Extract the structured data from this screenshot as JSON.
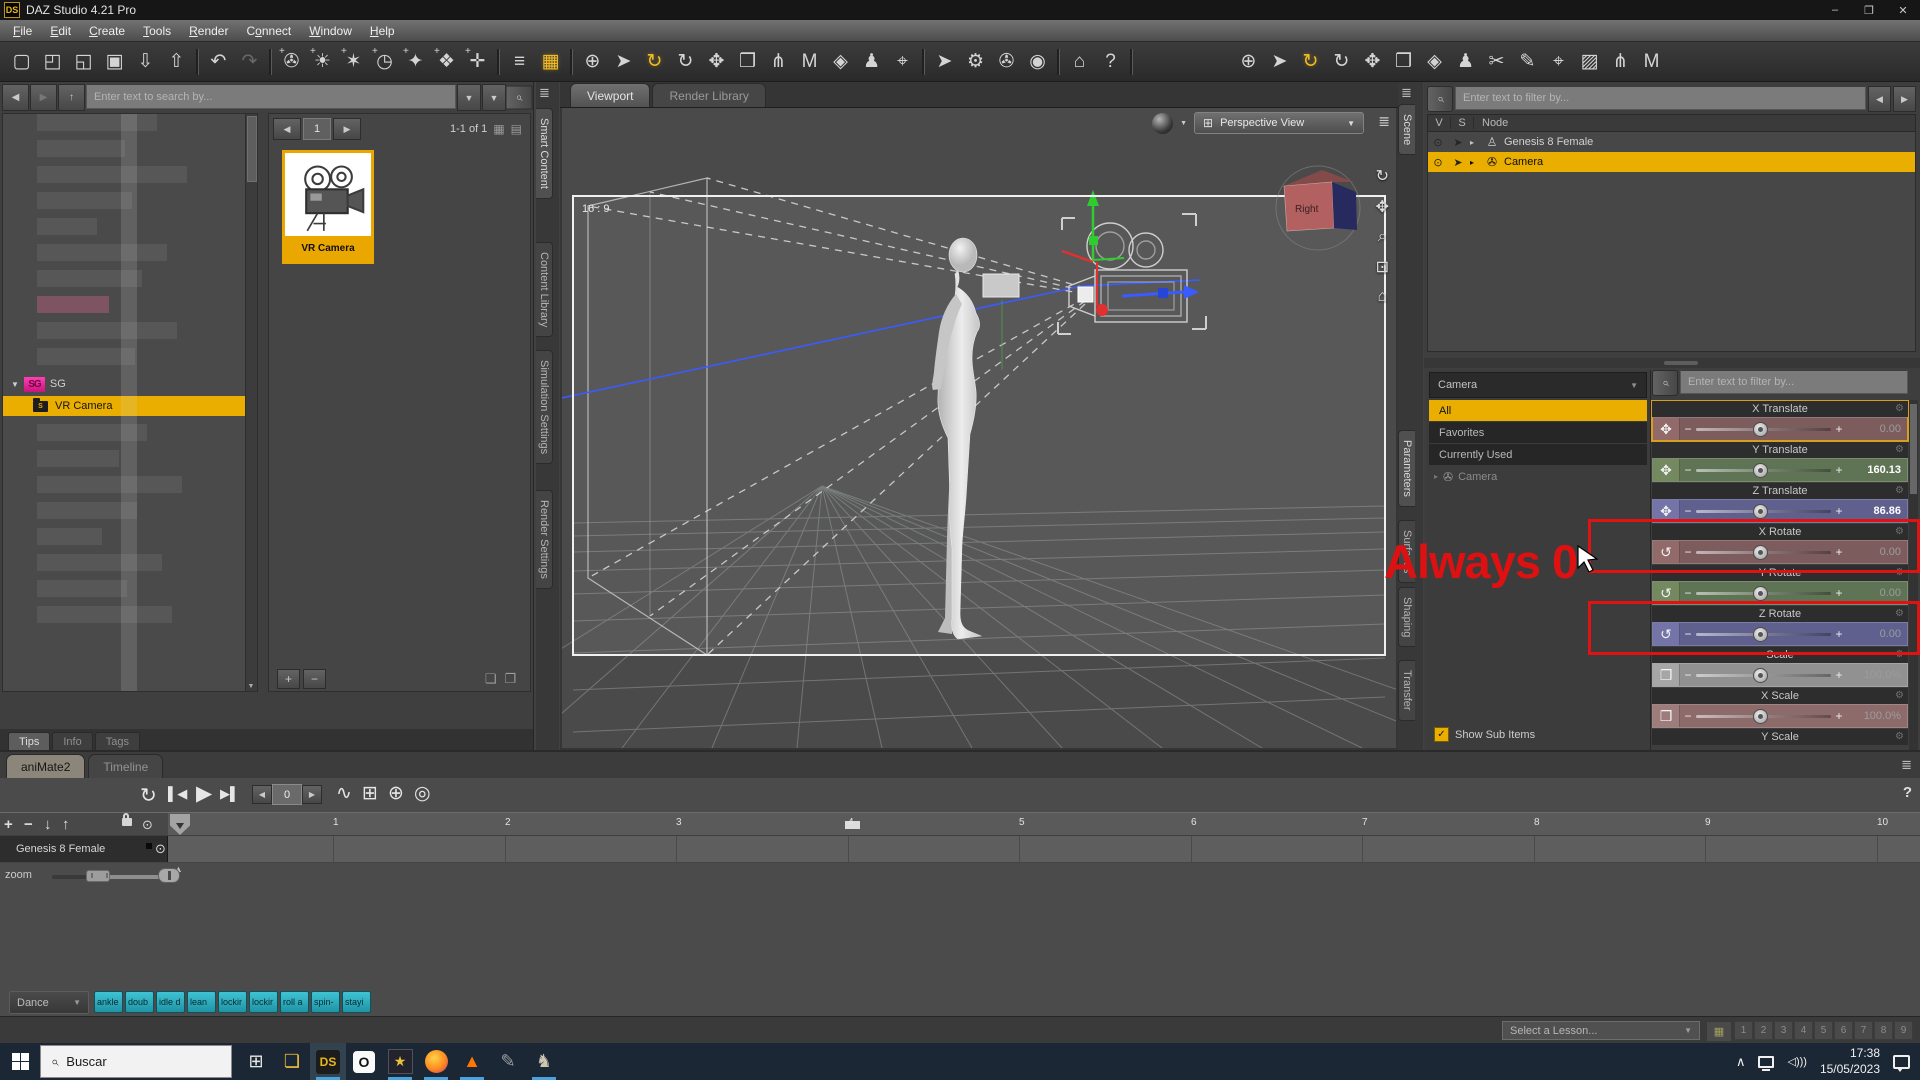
{
  "window": {
    "title": "DAZ Studio 4.21 Pro",
    "logo": "DS",
    "minimize": "–",
    "maximize": "❐",
    "close": "✕"
  },
  "menu": {
    "items": [
      {
        "label": "File",
        "u": 0
      },
      {
        "label": "Edit",
        "u": 0
      },
      {
        "label": "Create",
        "u": 0
      },
      {
        "label": "Tools",
        "u": 0
      },
      {
        "label": "Render",
        "u": 0
      },
      {
        "label": "Connect",
        "u": 1
      },
      {
        "label": "Window",
        "u": 0
      },
      {
        "label": "Help",
        "u": 0
      }
    ]
  },
  "toolbar": {
    "icons": [
      {
        "n": "new-file-icon",
        "g": "▢"
      },
      {
        "n": "open-file-icon",
        "g": "◰"
      },
      {
        "n": "merge-file-icon",
        "g": "◱"
      },
      {
        "n": "save-file-icon",
        "g": "▣"
      },
      {
        "n": "import-icon",
        "g": "⇩"
      },
      {
        "n": "export-icon",
        "g": "⇧"
      },
      {
        "sep": true
      },
      {
        "n": "undo-icon",
        "g": "↶"
      },
      {
        "n": "redo-icon",
        "g": "↷",
        "dim": true
      },
      {
        "sep": true
      },
      {
        "n": "new-camera-icon",
        "g": "✇",
        "plus": true
      },
      {
        "n": "new-distant-light-icon",
        "g": "☀",
        "plus": true
      },
      {
        "n": "new-point-light-icon",
        "g": "✶",
        "plus": true
      },
      {
        "n": "new-linear-light-icon",
        "g": "◷",
        "plus": true
      },
      {
        "n": "new-spotlight-icon",
        "g": "✦",
        "plus": true
      },
      {
        "n": "new-group-icon",
        "g": "❖",
        "plus": true
      },
      {
        "n": "new-null-icon",
        "g": "✛",
        "plus": true
      },
      {
        "sep": true
      },
      {
        "n": "scene-list-icon",
        "g": "≡"
      },
      {
        "n": "content-grid-icon",
        "g": "▦",
        "active": true
      },
      {
        "sep": true
      },
      {
        "n": "orbit-tool-icon",
        "g": "⊕"
      },
      {
        "n": "node-select-tool-icon",
        "g": "➤"
      },
      {
        "n": "rotate-tool-icon",
        "g": "↻",
        "active": true
      },
      {
        "n": "rotate-icon",
        "g": "↻"
      },
      {
        "n": "translate-tool-icon",
        "g": "✥"
      },
      {
        "n": "scale-tool-icon",
        "g": "❒"
      },
      {
        "n": "bone-tool-icon",
        "g": "⋔"
      },
      {
        "n": "surface-tool-icon",
        "g": "M"
      },
      {
        "n": "geometry-tool-icon",
        "g": "◈"
      },
      {
        "n": "figure-tool-icon",
        "g": "♟"
      },
      {
        "n": "camera-tool-icon",
        "g": "⌖"
      },
      {
        "sep": true
      },
      {
        "n": "pointer-settings-icon",
        "g": "➤"
      },
      {
        "n": "tool-settings-icon",
        "g": "⚙"
      },
      {
        "n": "render-settings-icon",
        "g": "✇"
      },
      {
        "n": "render-icon",
        "g": "◉"
      },
      {
        "sep": true
      },
      {
        "n": "daz-home-icon",
        "g": "⌂"
      },
      {
        "n": "help-cursor-icon",
        "g": "?"
      },
      {
        "sep": true
      },
      {
        "space": true
      },
      {
        "n": "hub-icon",
        "g": "⊕"
      },
      {
        "n": "select-cursor-icon",
        "g": "➤"
      },
      {
        "n": "rotate-cursor-icon",
        "g": "↻",
        "active": true
      },
      {
        "n": "rotate2-icon",
        "g": "↻"
      },
      {
        "n": "translate2-icon",
        "g": "✥"
      },
      {
        "n": "scale2-icon",
        "g": "❒"
      },
      {
        "n": "geometry2-icon",
        "g": "◈"
      },
      {
        "n": "figure2-icon",
        "g": "♟"
      },
      {
        "n": "tools-scissors-icon",
        "g": "✂"
      },
      {
        "n": "node-editor-icon",
        "g": "✎"
      },
      {
        "n": "camera-cursor-icon",
        "g": "⌖"
      },
      {
        "n": "brushes-icon",
        "g": "▨"
      },
      {
        "n": "bone2-icon",
        "g": "⋔"
      },
      {
        "n": "surface2-icon",
        "g": "M"
      }
    ]
  },
  "left_panel": {
    "nav_back": "◀",
    "nav_fwd": "▶",
    "nav_up": "↑",
    "search_placeholder": "Enter text to search by...",
    "dd_arrow": "▼",
    "search_icon": "⌕",
    "pagination": {
      "prev": "◀",
      "page": "1",
      "next": "▶",
      "range": "1-1 of 1",
      "view_icons": [
        "▦",
        "▤"
      ]
    },
    "tree": {
      "caret": "▼",
      "badge": "SG",
      "folder_label": "SG",
      "selected_label": "VR Camera"
    },
    "thumbnail_label": "VR Camera",
    "footer": {
      "add": "+",
      "remove": "−",
      "page_icons": [
        "❏",
        "❐"
      ]
    },
    "tabs": [
      {
        "label": "Tips",
        "active": true
      },
      {
        "label": "Info"
      },
      {
        "label": "Tags"
      }
    ]
  },
  "left_tabstrip": {
    "tabs": [
      "Smart Content",
      "Content Library",
      "Simulation Settings",
      "Render Settings"
    ],
    "active": "Smart Content"
  },
  "viewport": {
    "tabs": [
      {
        "label": "Viewport",
        "active": true
      },
      {
        "label": "Render Library"
      }
    ],
    "view_selector": {
      "label": "Perspective View",
      "window_icon": "⊞",
      "arrow": "▼"
    },
    "aspect_label": "16 : 9",
    "cube_label": "Right",
    "nav_icons": [
      {
        "n": "orbit-icon",
        "g": "↻"
      },
      {
        "n": "pan-icon",
        "g": "✥"
      },
      {
        "n": "zoom-icon",
        "g": "⌕"
      },
      {
        "n": "frame-icon",
        "g": "⊡"
      },
      {
        "n": "home-icon",
        "g": "⌂"
      }
    ]
  },
  "right_tabstrip": {
    "top": [
      "Scene"
    ],
    "bottom": [
      "Parameters",
      "Surfaces",
      "Shaping",
      "Transfer"
    ],
    "active": [
      "Scene",
      "Parameters"
    ]
  },
  "scene_panel": {
    "filter_placeholder": "Enter text to filter by...",
    "search_icon": "⌕",
    "nav_prev": "◀",
    "nav_next": "▶",
    "columns": [
      "V",
      "S",
      "Node"
    ],
    "rows": [
      {
        "label": "Genesis 8 Female",
        "icon": "figure",
        "selected": false
      },
      {
        "label": "Camera",
        "icon": "camera",
        "selected": true
      }
    ]
  },
  "parameters_panel": {
    "group_selector": "Camera",
    "groups": [
      {
        "label": "All",
        "selected": true
      },
      {
        "label": "Favorites"
      },
      {
        "label": "Currently Used"
      }
    ],
    "tree_item": "Camera",
    "filter_placeholder": "Enter text to filter by...",
    "show_sub_items": "Show Sub Items",
    "sliders": [
      {
        "label": "X Translate",
        "value": "0.00",
        "color": "red",
        "icon": "translate",
        "selected": true,
        "dimval": true
      },
      {
        "label": "Y Translate",
        "value": "160.13",
        "color": "green",
        "icon": "translate"
      },
      {
        "label": "Z Translate",
        "value": "86.86",
        "color": "blue",
        "icon": "translate"
      },
      {
        "label": "X Rotate",
        "value": "0.00",
        "color": "red",
        "icon": "rotate",
        "annotated": true,
        "dimval": true
      },
      {
        "label": "Y Rotate",
        "value": "0.00",
        "color": "green",
        "icon": "rotate",
        "dimval": true
      },
      {
        "label": "Z Rotate",
        "value": "0.00",
        "color": "blue",
        "icon": "rotate",
        "annotated": true,
        "dimval": true
      },
      {
        "label": "Scale",
        "value": "100.0%",
        "color": "gray",
        "icon": "scale",
        "dimval": true
      },
      {
        "label": "X Scale",
        "value": "100.0%",
        "color": "red2",
        "icon": "scale",
        "dimval": true
      },
      {
        "label": "Y Scale",
        "value": "",
        "color": "green",
        "icon": "scale",
        "partial": true
      }
    ]
  },
  "annotation": {
    "text": "Always 0"
  },
  "animate_panel": {
    "tabs": [
      {
        "label": "aniMate2",
        "active": true
      },
      {
        "label": "Timeline"
      }
    ],
    "transport": {
      "loop": "↻",
      "skip_start": "▌◀",
      "play": "▶",
      "skip_end": "▶▌",
      "frame_prev": "◀",
      "frame_value": "0",
      "frame_next": "▶",
      "extra_icons": [
        {
          "n": "motion-icon",
          "g": "∿"
        },
        {
          "n": "add-block-icon",
          "g": "⊞"
        },
        {
          "n": "add-audio-icon",
          "g": "⊕"
        },
        {
          "n": "record-icon",
          "g": "◎"
        }
      ]
    },
    "edit_icons": [
      "+",
      "−",
      "↓",
      "↑"
    ],
    "ruler": [
      "1",
      "2",
      "3",
      "4",
      "5",
      "6",
      "7",
      "8",
      "9",
      "10"
    ],
    "track_label": "Genesis 8 Female",
    "zoom_label": "zoom",
    "help_icon": "?",
    "clip_group": "Dance",
    "clips": [
      "ankle",
      "doub",
      "idle d",
      "lean",
      "lockir",
      "lockir",
      "roll a",
      "spin-",
      "stayi"
    ]
  },
  "lesson_bar": {
    "dropdown": "Select a Lesson...",
    "grid_icon": "▦",
    "numbers": [
      "1",
      "2",
      "3",
      "4",
      "5",
      "6",
      "7",
      "8",
      "9"
    ]
  },
  "taskbar": {
    "search_placeholder": "Buscar",
    "apps": [
      {
        "n": "task-view-icon",
        "g": "⊞",
        "c": "#e8e8e8",
        "running": false
      },
      {
        "n": "file-explorer-icon",
        "g": "❏",
        "c": "#f0c23c",
        "running": false
      },
      {
        "n": "daz-studio-icon",
        "label": "DS",
        "type": "ds",
        "active": true,
        "running": true
      },
      {
        "n": "obsidian-icon",
        "g": "O",
        "type": "ob",
        "running": false
      },
      {
        "n": "media-player-icon",
        "g": "★",
        "type": "star",
        "running": true
      },
      {
        "n": "firefox-icon",
        "type": "ff",
        "running": true
      },
      {
        "n": "vlc-icon",
        "g": "▲",
        "c": "#ff7700",
        "running": true
      },
      {
        "n": "utility-icon",
        "g": "✎",
        "c": "#9aa0a0",
        "running": false
      },
      {
        "n": "gimp-icon",
        "g": "♞",
        "c": "#cfc6b4",
        "running": true
      }
    ],
    "tray": {
      "chevron": "∧",
      "speaker": "◁)))",
      "time": "17:38",
      "date": "15/05/2023"
    }
  }
}
